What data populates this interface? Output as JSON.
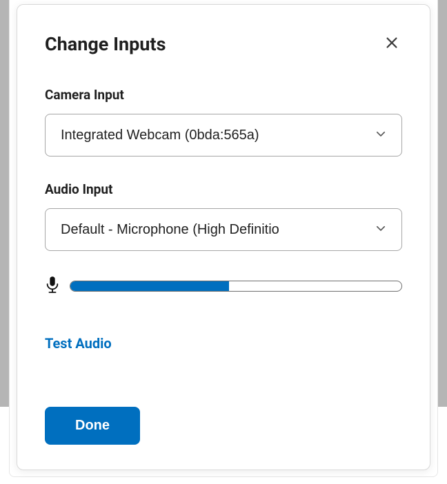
{
  "modal": {
    "title": "Change Inputs"
  },
  "camera": {
    "label": "Camera Input",
    "selected": "Integrated Webcam (0bda:565a)"
  },
  "audio": {
    "label": "Audio Input",
    "selected": "Default - Microphone (High Definitio",
    "level_percent": 48
  },
  "links": {
    "test_audio": "Test Audio"
  },
  "buttons": {
    "done": "Done"
  }
}
